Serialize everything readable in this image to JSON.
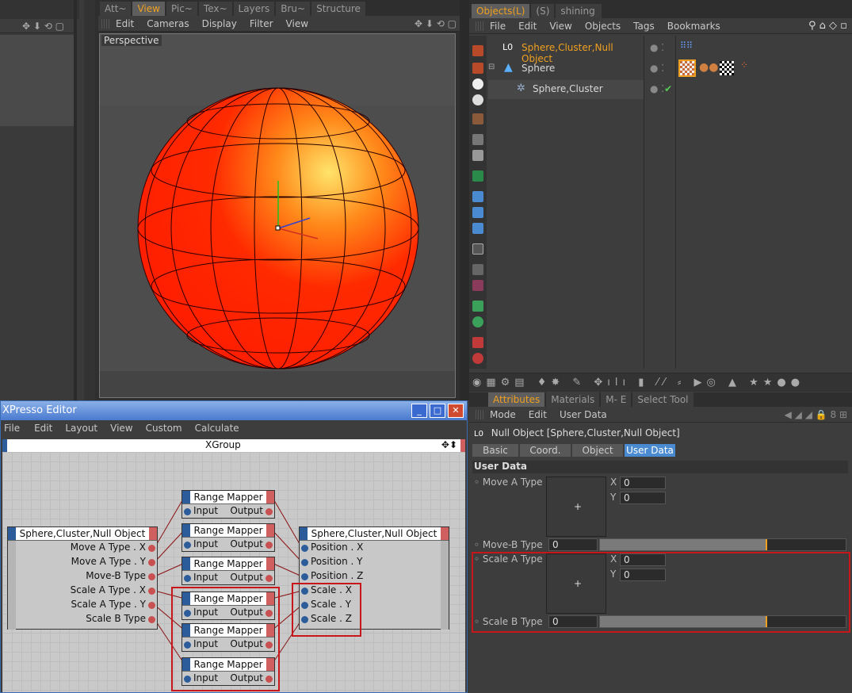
{
  "left_panel": {
    "visible": true
  },
  "viewport": {
    "tabs": [
      "Att~",
      "View",
      "Pic~",
      "Tex~",
      "Layers",
      "Bru~",
      "Structure"
    ],
    "active_tab": "View",
    "menu": [
      "Edit",
      "Cameras",
      "Display",
      "Filter",
      "View"
    ],
    "label": "Perspective"
  },
  "objects": {
    "tabs": [
      "Objects(L)",
      "(S)",
      "shining"
    ],
    "menu": [
      "File",
      "Edit",
      "View",
      "Objects",
      "Tags",
      "Bookmarks"
    ],
    "tree": [
      {
        "name": "Sphere,Cluster,Null Object",
        "selected": true
      },
      {
        "name": "Sphere",
        "selected": false
      },
      {
        "name": "Sphere,Cluster",
        "selected": false
      }
    ]
  },
  "attributes": {
    "tabs": [
      "Attributes",
      "Materials",
      "M- E",
      "Select Tool"
    ],
    "menu": [
      "Mode",
      "Edit",
      "User Data"
    ],
    "object_label": "Null Object [Sphere,Cluster,Null Object]",
    "subtabs": [
      "Basic",
      "Coord.",
      "Object",
      "User Data"
    ],
    "active_subtab": "User Data",
    "section": "User Data",
    "rows": {
      "move_a": {
        "label": "Move A Type",
        "x_label": "X",
        "x": "0",
        "y_label": "Y",
        "y": "0"
      },
      "move_b": {
        "label": "Move-B Type",
        "value": "0",
        "slider_fraction": 0.68
      },
      "scale_a": {
        "label": "Scale A Type",
        "x_label": "X",
        "x": "0",
        "y_label": "Y",
        "y": "0"
      },
      "scale_b": {
        "label": "Scale B Type",
        "value": "0",
        "slider_fraction": 0.68
      }
    }
  },
  "xpresso": {
    "title": "XPresso Editor",
    "menu": [
      "File",
      "Edit",
      "Layout",
      "View",
      "Custom",
      "Calculate"
    ],
    "group": "XGroup",
    "source_node": {
      "title": "Sphere,Cluster,Null Object",
      "ports": [
        "Move A Type . X",
        "Move A Type . Y",
        "Move-B Type",
        "Scale A Type . X",
        "Scale A Type . Y",
        "Scale B Type"
      ]
    },
    "mapper": {
      "title": "Range Mapper",
      "input": "Input",
      "output": "Output"
    },
    "target_node": {
      "title": "Sphere,Cluster,Null Object",
      "ports": [
        "Position . X",
        "Position . Y",
        "Position . Z",
        "Scale . X",
        "Scale . Y",
        "Scale . Z"
      ]
    }
  },
  "colors": {
    "accent": "#f0a020",
    "highlight": "#c8161d",
    "sphere": "#ff2a00"
  }
}
